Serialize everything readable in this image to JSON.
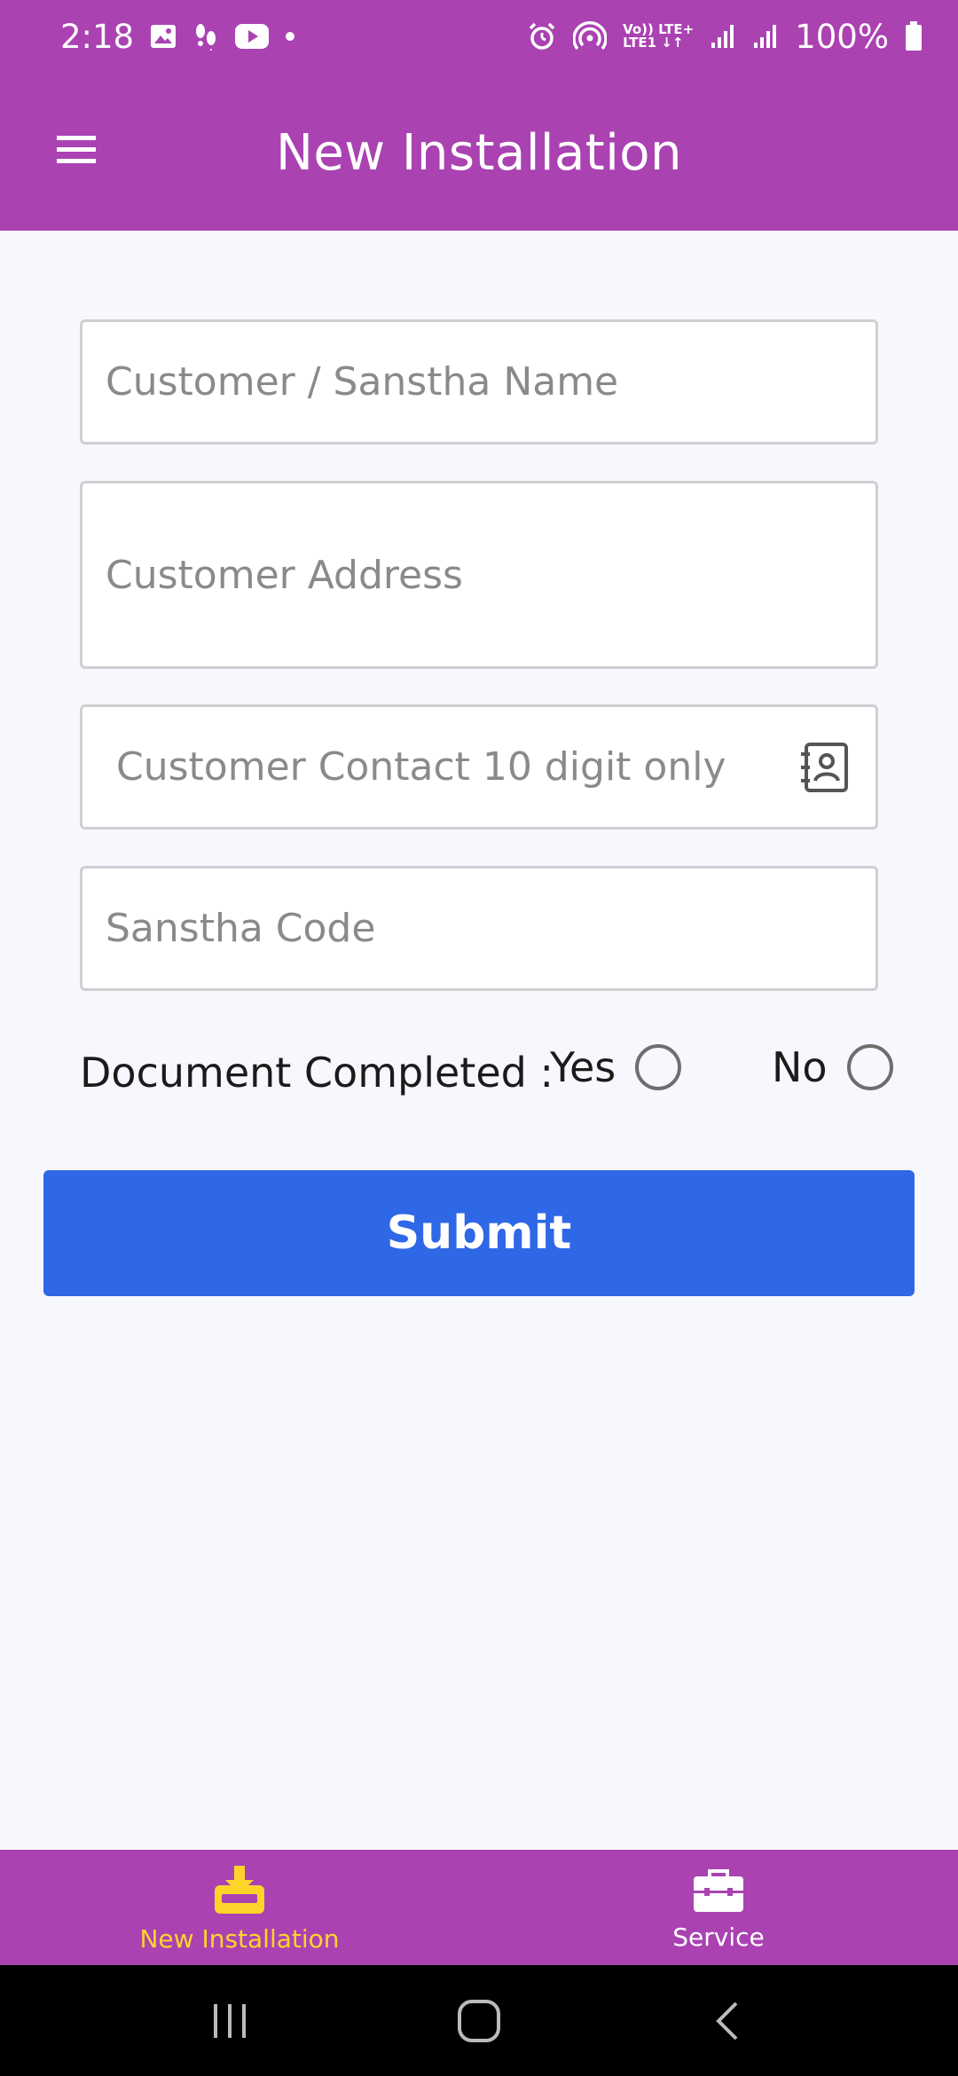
{
  "status_bar": {
    "time": "2:18",
    "net_line1": "Vo)) LTE+",
    "net_line2": "LTE1 ↓↑",
    "battery": "100%"
  },
  "app_bar": {
    "title": "New Installation",
    "menu_icon": "hamburger-menu-icon"
  },
  "form": {
    "customer_name_placeholder": "Customer / Sanstha Name",
    "customer_address_placeholder": "Customer Address",
    "customer_contact_placeholder": "Customer Contact 10 digit only",
    "sanstha_code_placeholder": "Sanstha Code",
    "document_completed_label": "Document Completed :",
    "yes_label": "Yes",
    "no_label": "No",
    "submit_label": "Submit"
  },
  "bottom_nav": {
    "items": [
      {
        "label": "New Installation",
        "icon": "inbox-download-icon",
        "active": true
      },
      {
        "label": "Service",
        "icon": "toolbox-icon",
        "active": false
      }
    ]
  },
  "colors": {
    "primary": "#aa42b2",
    "submit": "#2f68e6",
    "active_nav": "#ffd42a",
    "background": "#f7f8fd"
  }
}
